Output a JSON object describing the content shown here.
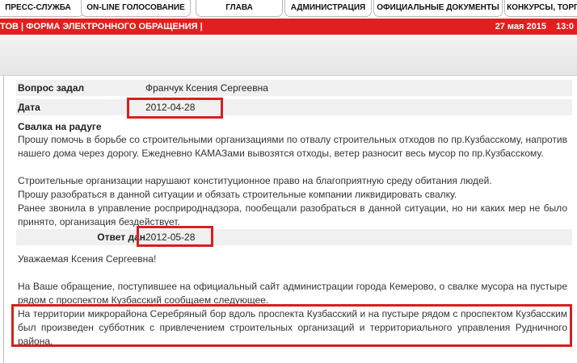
{
  "nav": {
    "tabs": [
      "ПРЕСС-СЛУЖБА",
      "ON-LINE ГОЛОСОВАНИЕ",
      "ГЛАВА",
      "АДМИНИСТРАЦИЯ",
      "ОФИЦИАЛЬНЫЕ ДОКУМЕНТЫ",
      "КОНКУРСЫ, ТОРГИ"
    ]
  },
  "breadcrumb": "ТОВ | ФОРМА ЭЛЕКТРОННОГО ОБРАЩЕНИЯ |",
  "header_date": "27 мая 2015",
  "header_time": "13:0",
  "question": {
    "asked_by_label": "Вопрос задал",
    "asked_by_value": "Франчук Ксения Сергеевна",
    "date_label": "Дата",
    "date_value": "2012-04-28",
    "title": "Свалка на радуге",
    "paragraphs": [
      "Прошу помочь в борьбе со строительными организациями по отвалу строительных отходов по пр.Кузбасскому, напротив нашего дома через дорогу. Ежедневно КАМАЗами вывозятся отходы, ветер разносит весь мусор по пр.Кузбасскому.",
      "Строительные организации нарушают конституционное право на благоприятную среду обитания людей.",
      "Прошу разобраться в данной ситуации и обязать строительные компании ликвидировать свалку.",
      "Ранее звонила в управление росприроднадзора, пообещали разобраться в данной ситуации, но ни каких мер не было принято, организация бездействует."
    ]
  },
  "answer": {
    "date_label": "Ответ дан",
    "date_value": "2012-05-28",
    "greeting": "Уважаемая Ксения Сергеевна!",
    "paragraphs": [
      "На Ваше обращение, поступившее на официальный сайт администрации города Кемерово, о свалке мусора на пустыре рядом с проспектом Кузбасский сообщаем следующее.",
      "На территории микрорайона Серебряный бор вдоль проспекта Кузбасский и на пустыре рядом с проспектом Кузбасским был произведен субботник с привлечением строительных организаций и территориального управления Рудничного района."
    ]
  },
  "colors": {
    "header_red": "#e21f1f",
    "highlight_red": "#d42020",
    "row_bg": "#f0f0f0"
  }
}
